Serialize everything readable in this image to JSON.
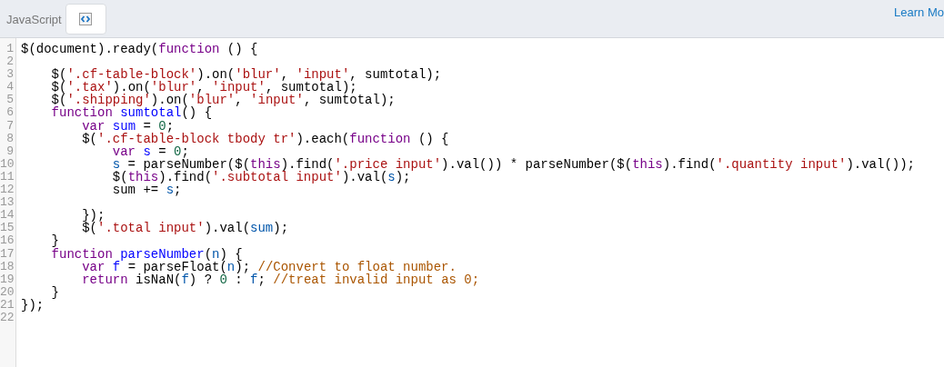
{
  "header": {
    "language": "JavaScript",
    "link": "Learn Mo"
  },
  "editor": {
    "lines": [
      {
        "number": "1",
        "tokens": [
          {
            "kind": "plain",
            "text": "$(document).ready("
          },
          {
            "kind": "keyword",
            "text": "function"
          },
          {
            "kind": "plain",
            "text": " () {"
          }
        ]
      },
      {
        "number": "2"
      },
      {
        "number": "3",
        "tokens": [
          {
            "kind": "plain",
            "text": "    $("
          },
          {
            "kind": "string",
            "text": "'.cf-table-block'"
          },
          {
            "kind": "plain",
            "text": ").on("
          },
          {
            "kind": "string",
            "text": "'blur'"
          },
          {
            "kind": "plain",
            "text": ", "
          },
          {
            "kind": "string",
            "text": "'input'"
          },
          {
            "kind": "plain",
            "text": ", sumtotal);"
          }
        ]
      },
      {
        "number": "4",
        "tokens": [
          {
            "kind": "plain",
            "text": "    $("
          },
          {
            "kind": "string",
            "text": "'.tax'"
          },
          {
            "kind": "plain",
            "text": ").on("
          },
          {
            "kind": "string",
            "text": "'blur'"
          },
          {
            "kind": "plain",
            "text": ", "
          },
          {
            "kind": "string",
            "text": "'input'"
          },
          {
            "kind": "plain",
            "text": ", sumtotal);"
          }
        ]
      },
      {
        "number": "5",
        "tokens": [
          {
            "kind": "plain",
            "text": "    $("
          },
          {
            "kind": "string",
            "text": "'.shipping'"
          },
          {
            "kind": "plain",
            "text": ").on("
          },
          {
            "kind": "string",
            "text": "'blur'"
          },
          {
            "kind": "plain",
            "text": ", "
          },
          {
            "kind": "string",
            "text": "'input'"
          },
          {
            "kind": "plain",
            "text": ", sumtotal);"
          }
        ]
      },
      {
        "number": "6",
        "tokens": [
          {
            "kind": "keyword",
            "text": "    function "
          },
          {
            "kind": "def",
            "text": "sumtotal"
          },
          {
            "kind": "plain",
            "text": "() {"
          }
        ]
      },
      {
        "number": "7",
        "tokens": [
          {
            "kind": "keyword",
            "text": "        var "
          },
          {
            "kind": "def",
            "text": "sum"
          },
          {
            "kind": "plain",
            "text": " = "
          },
          {
            "kind": "number",
            "text": "0"
          },
          {
            "kind": "plain",
            "text": ";"
          }
        ]
      },
      {
        "number": "8",
        "tokens": [
          {
            "kind": "plain",
            "text": "        $("
          },
          {
            "kind": "string",
            "text": "'.cf-table-block tbody tr'"
          },
          {
            "kind": "plain",
            "text": ").each("
          },
          {
            "kind": "keyword",
            "text": "function"
          },
          {
            "kind": "plain",
            "text": " () {"
          }
        ]
      },
      {
        "number": "9",
        "tokens": [
          {
            "kind": "keyword",
            "text": "            var "
          },
          {
            "kind": "def",
            "text": "s"
          },
          {
            "kind": "plain",
            "text": " = "
          },
          {
            "kind": "number",
            "text": "0"
          },
          {
            "kind": "plain",
            "text": ";"
          }
        ]
      },
      {
        "number": "10",
        "tokens": [
          {
            "kind": "variable",
            "text": "            s"
          },
          {
            "kind": "plain",
            "text": " = parseNumber($("
          },
          {
            "kind": "keyword",
            "text": "this"
          },
          {
            "kind": "plain",
            "text": ").find("
          },
          {
            "kind": "string",
            "text": "'.price input'"
          },
          {
            "kind": "plain",
            "text": ").val()) * parseNumber($("
          },
          {
            "kind": "keyword",
            "text": "this"
          },
          {
            "kind": "plain",
            "text": ").find("
          },
          {
            "kind": "string",
            "text": "'.quantity input'"
          },
          {
            "kind": "plain",
            "text": ").val());"
          }
        ]
      },
      {
        "number": "11",
        "tokens": [
          {
            "kind": "plain",
            "text": "            $("
          },
          {
            "kind": "keyword",
            "text": "this"
          },
          {
            "kind": "plain",
            "text": ").find("
          },
          {
            "kind": "string",
            "text": "'.subtotal input'"
          },
          {
            "kind": "plain",
            "text": ").val("
          },
          {
            "kind": "variable",
            "text": "s"
          },
          {
            "kind": "plain",
            "text": ");"
          }
        ]
      },
      {
        "number": "12",
        "tokens": [
          {
            "kind": "plain",
            "text": "            sum += "
          },
          {
            "kind": "variable",
            "text": "s"
          },
          {
            "kind": "plain",
            "text": ";"
          }
        ]
      },
      {
        "number": "13"
      },
      {
        "number": "14",
        "tokens": [
          {
            "kind": "plain",
            "text": "        });"
          }
        ]
      },
      {
        "number": "15",
        "tokens": [
          {
            "kind": "plain",
            "text": "        $("
          },
          {
            "kind": "string",
            "text": "'.total input'"
          },
          {
            "kind": "plain",
            "text": ").val("
          },
          {
            "kind": "variable",
            "text": "sum"
          },
          {
            "kind": "plain",
            "text": ");"
          }
        ]
      },
      {
        "number": "16",
        "tokens": [
          {
            "kind": "plain",
            "text": "    }"
          }
        ]
      },
      {
        "number": "17",
        "tokens": [
          {
            "kind": "keyword",
            "text": "    function "
          },
          {
            "kind": "def",
            "text": "parseNumber"
          },
          {
            "kind": "plain",
            "text": "("
          },
          {
            "kind": "variable",
            "text": "n"
          },
          {
            "kind": "plain",
            "text": ") {"
          }
        ]
      },
      {
        "number": "18",
        "tokens": [
          {
            "kind": "keyword",
            "text": "        var "
          },
          {
            "kind": "def",
            "text": "f"
          },
          {
            "kind": "plain",
            "text": " = parseFloat("
          },
          {
            "kind": "variable",
            "text": "n"
          },
          {
            "kind": "plain",
            "text": "); "
          },
          {
            "kind": "comment",
            "text": "//Convert to float number."
          }
        ]
      },
      {
        "number": "19",
        "tokens": [
          {
            "kind": "keyword",
            "text": "        return"
          },
          {
            "kind": "plain",
            "text": " isNaN("
          },
          {
            "kind": "variable",
            "text": "f"
          },
          {
            "kind": "plain",
            "text": ") ? "
          },
          {
            "kind": "number",
            "text": "0"
          },
          {
            "kind": "plain",
            "text": " : "
          },
          {
            "kind": "variable",
            "text": "f"
          },
          {
            "kind": "plain",
            "text": "; "
          },
          {
            "kind": "comment",
            "text": "//treat invalid input as 0;"
          }
        ]
      },
      {
        "number": "20",
        "tokens": [
          {
            "kind": "plain",
            "text": "    }"
          }
        ]
      },
      {
        "number": "21",
        "tokens": [
          {
            "kind": "plain",
            "text": "});"
          }
        ]
      },
      {
        "number": "22"
      }
    ]
  }
}
